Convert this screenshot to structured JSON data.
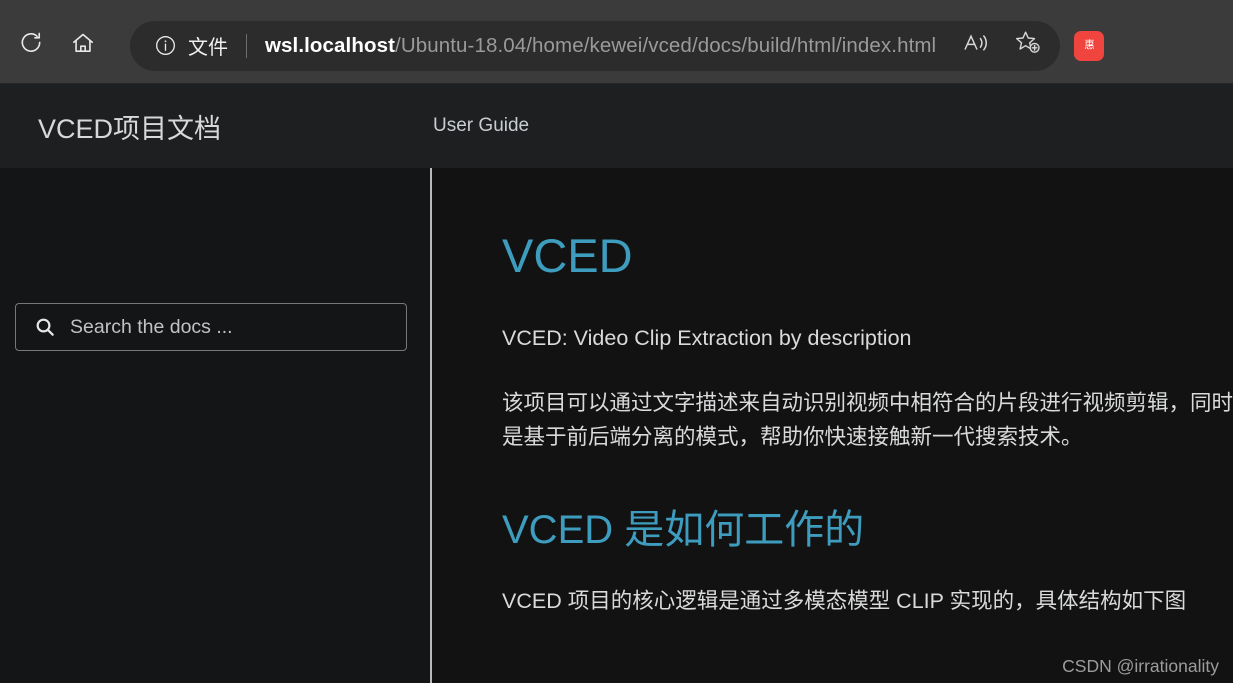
{
  "browser": {
    "reload_icon": "reload-icon",
    "home_icon": "home-icon",
    "address": {
      "site_info_icon": "info-circle-icon",
      "site_info_label": "文件",
      "url_host": "wsl.localhost",
      "url_path": "/Ubuntu-18.04/home/kewei/vced/docs/build/html/index.html",
      "full_url": "wsl.localhost/Ubuntu-18.04/home/kewei/vced/docs/build/html/index.html"
    },
    "read_aloud_icon": "read-aloud-icon",
    "favorites_icon": "favorite-star-add-icon",
    "extension_badge_label": "惠",
    "extension_badge_color": "#f0443e",
    "chrome_background": "#3b3b3b",
    "address_bar_background": "#2c2c2c"
  },
  "site_header": {
    "title": "VCED项目文档",
    "nav": [
      {
        "label": "User Guide"
      }
    ],
    "background": "#1d1f21"
  },
  "sidebar": {
    "search": {
      "placeholder": "Search the docs ...",
      "value": "",
      "icon": "search-icon"
    }
  },
  "content": {
    "heading": "VCED",
    "subtitle": "VCED: Video Clip Extraction by description",
    "intro_paragraph": "该项目可以通过文字描述来自动识别视频中相符合的片段进行视频剪辑，同时也是基于前后端分离的模式，帮助你快速接触新一代搜索技术。",
    "section_heading": "VCED 是如何工作的",
    "section_paragraph": "VCED 项目的核心逻辑是通过多模态模型 CLIP 实现的，具体结构如下图",
    "heading_color": "#3e9cbe",
    "text_color": "#d9dadb",
    "background": "#121212"
  },
  "watermark": {
    "text": "CSDN @irrationality"
  }
}
